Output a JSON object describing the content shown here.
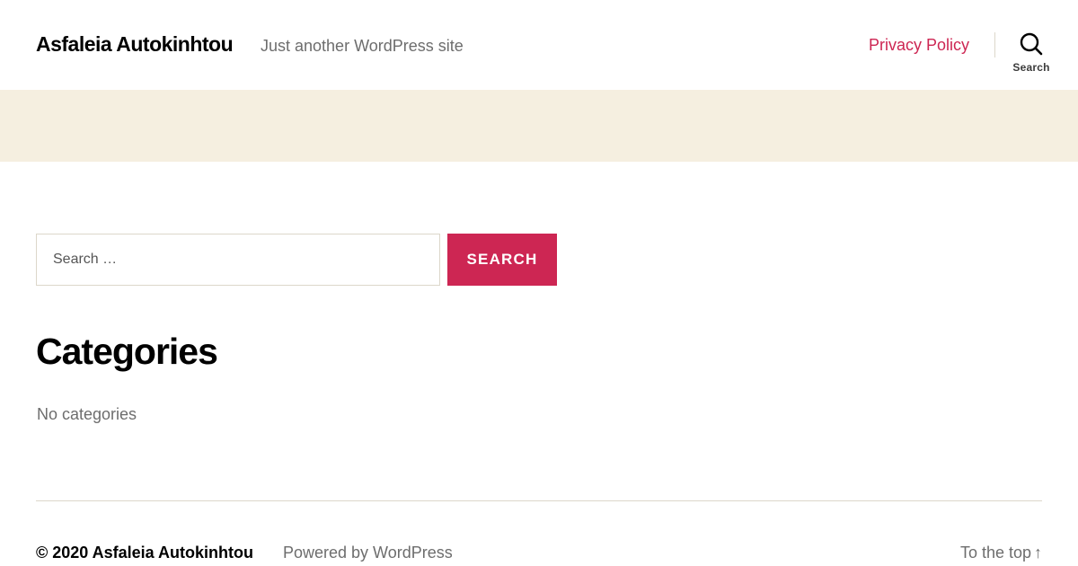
{
  "header": {
    "site_title": "Asfaleia Autokinhtou",
    "site_description": "Just another WordPress site",
    "nav": [
      {
        "label": "Privacy Policy"
      }
    ],
    "search_toggle": {
      "icon": "search-icon",
      "label": "Search"
    }
  },
  "search_form": {
    "placeholder": "Search …",
    "value": "",
    "submit_label": "Search"
  },
  "widget": {
    "title": "Categories",
    "empty_text": "No categories"
  },
  "footer": {
    "copyright": "© 2020 Asfaleia Autokinhtou",
    "powered_by": "Powered by WordPress",
    "to_top": "To the top",
    "to_top_arrow": "↑"
  },
  "colors": {
    "accent": "#cd2653",
    "cover_band": "#f5efe0",
    "secondary_text": "#6d6d6d",
    "border": "#dcd7ca"
  }
}
